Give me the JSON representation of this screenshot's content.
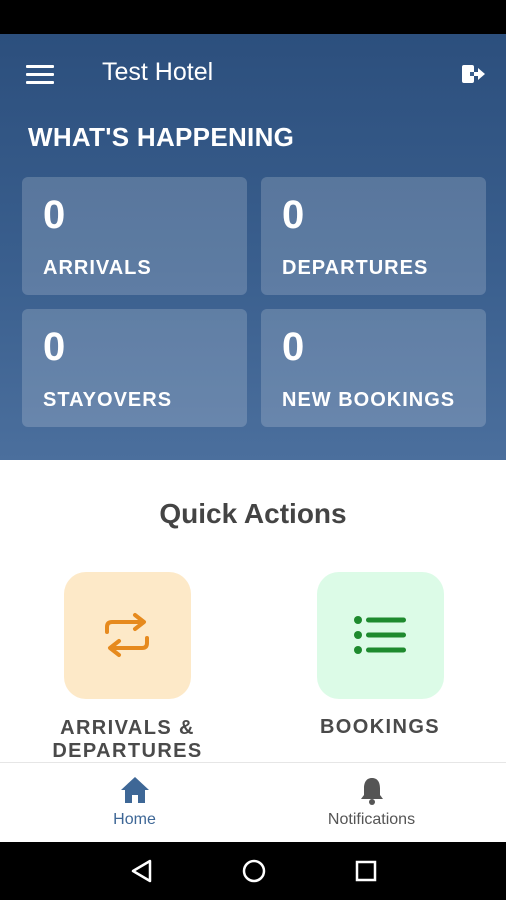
{
  "app": {
    "title": "Test Hotel"
  },
  "icons": {
    "menu": "hamburger-menu-icon",
    "logout": "logout-icon",
    "swap": "swap-arrows-icon",
    "list": "list-icon",
    "home": "home-icon",
    "bell": "bell-icon"
  },
  "colors": {
    "accent": "#3e6796",
    "hero_top": "#2c4f7d",
    "arrivals_tile": "#fde9c8",
    "arrivals_icon": "#e68a1e",
    "bookings_tile": "#dcfbe7",
    "bookings_icon": "#1e8a2e"
  },
  "happening": {
    "title": "WHAT'S HAPPENING",
    "stats": [
      {
        "value": "0",
        "label": "ARRIVALS"
      },
      {
        "value": "0",
        "label": "DEPARTURES"
      },
      {
        "value": "0",
        "label": "STAYOVERS"
      },
      {
        "value": "0",
        "label": "NEW BOOKINGS"
      }
    ]
  },
  "quick_actions": {
    "title": "Quick Actions",
    "items": [
      {
        "label_line1": "ARRIVALS &",
        "label_line2": "DEPARTURES"
      },
      {
        "label": "BOOKINGS"
      }
    ]
  },
  "bottom_nav": [
    {
      "label": "Home",
      "active": true
    },
    {
      "label": "Notifications",
      "active": false
    }
  ]
}
